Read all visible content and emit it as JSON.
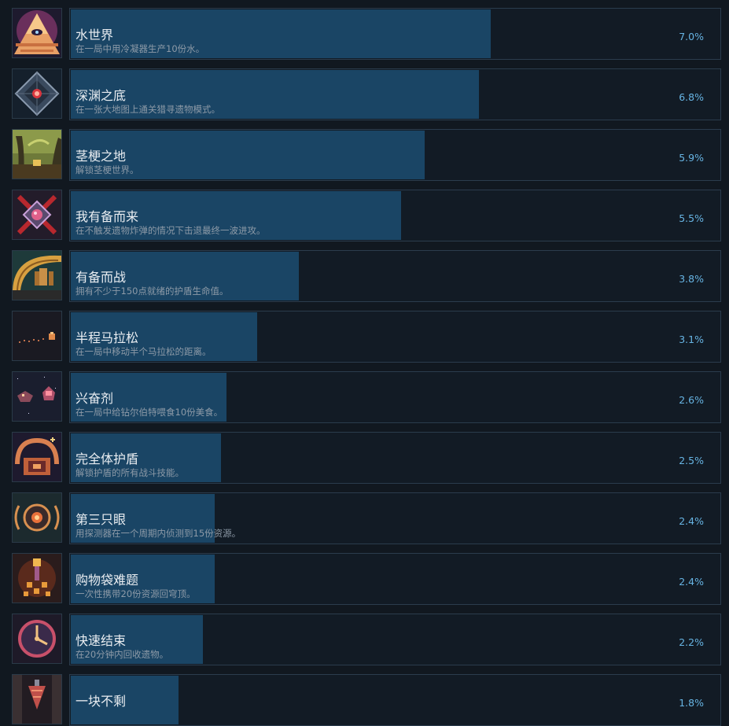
{
  "colors": {
    "background": "#111820",
    "card_background": "#121b25",
    "card_border": "#2b3c4d",
    "progress_fill": "#1a4565",
    "title_text": "#e9edf1",
    "description_text": "#8d9aa7",
    "percent_text": "#67b4e3"
  },
  "achievements": [
    {
      "name": "水世界",
      "description": "在一局中用冷凝器生产10份水。",
      "percent": "7.0%",
      "rate": 0.07,
      "icon": "pyramid-eye-icon"
    },
    {
      "name": "深渊之底",
      "description": "在一张大地图上通关猎寻遗物模式。",
      "percent": "6.8%",
      "rate": 0.068,
      "icon": "abyss-diamond-icon"
    },
    {
      "name": "茎梗之地",
      "description": "解锁茎梗世界。",
      "percent": "5.9%",
      "rate": 0.059,
      "icon": "stalk-world-icon"
    },
    {
      "name": "我有备而来",
      "description": "在不触发遗物炸弹的情况下击退最终一波进攻。",
      "percent": "5.5%",
      "rate": 0.055,
      "icon": "relic-bomb-icon"
    },
    {
      "name": "有备而战",
      "description": "拥有不少于150点就绪的护盾生命值。",
      "percent": "3.8%",
      "rate": 0.038,
      "icon": "shield-dome-icon"
    },
    {
      "name": "半程马拉松",
      "description": "在一局中移动半个马拉松的距离。",
      "percent": "3.1%",
      "rate": 0.031,
      "icon": "marathon-trail-icon"
    },
    {
      "name": "兴奋剂",
      "description": "在一局中给钻尔伯特喂食10份美食。",
      "percent": "2.6%",
      "rate": 0.026,
      "icon": "creature-feed-icon"
    },
    {
      "name": "完全体护盾",
      "description": "解锁护盾的所有战斗技能。",
      "percent": "2.5%",
      "rate": 0.025,
      "icon": "full-shield-icon"
    },
    {
      "name": "第三只眼",
      "description": "用探测器在一个周期内侦测到15份资源。",
      "percent": "2.4%",
      "rate": 0.024,
      "icon": "scanner-eye-icon"
    },
    {
      "name": "购物袋难题",
      "description": "一次性携带20份资源回穹顶。",
      "percent": "2.4%",
      "rate": 0.024,
      "icon": "resource-carry-icon"
    },
    {
      "name": "快速结束",
      "description": "在20分钟内回收遗物。",
      "percent": "2.2%",
      "rate": 0.022,
      "icon": "clock-icon"
    },
    {
      "name": "一块不剩",
      "description": "",
      "percent": "1.8%",
      "rate": 0.018,
      "icon": "drill-shaft-icon"
    }
  ]
}
